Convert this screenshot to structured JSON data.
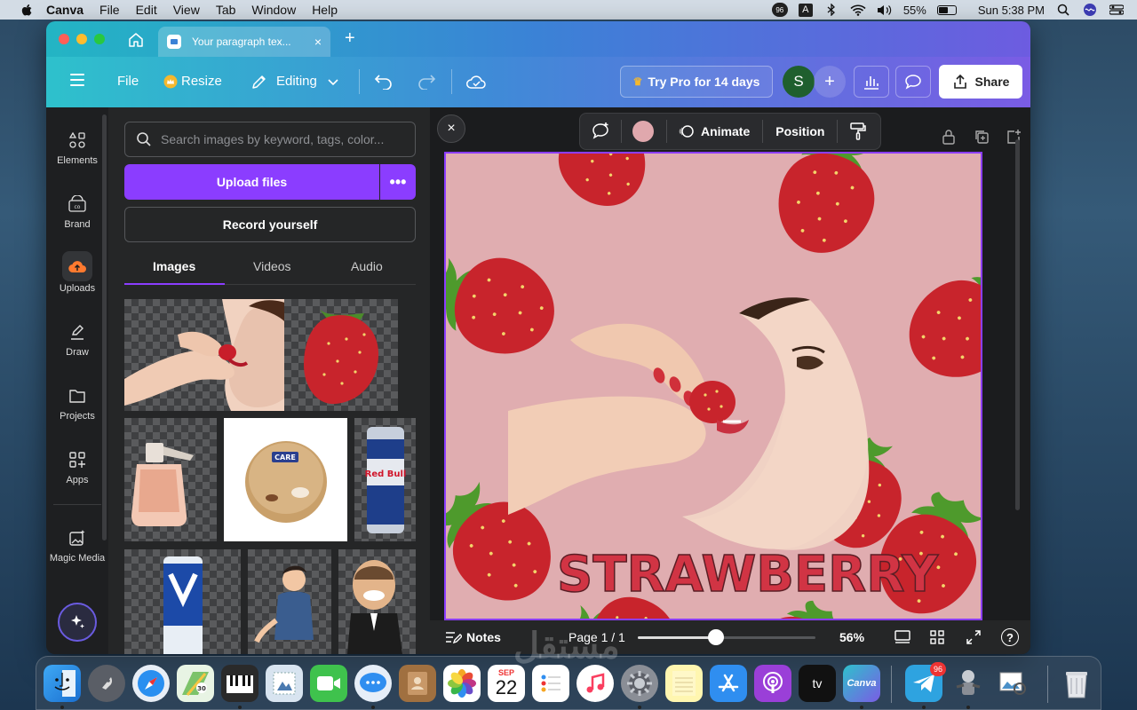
{
  "menubar": {
    "app": "Canva",
    "items": [
      "File",
      "Edit",
      "View",
      "Tab",
      "Window",
      "Help"
    ],
    "badge": "96",
    "input_letter": "A",
    "battery": "55%",
    "clock": "Sun 5:38 PM"
  },
  "browser": {
    "tab_title": "Your paragraph tex...",
    "tab_close": "×",
    "new_tab": "+"
  },
  "toolbar": {
    "file": "File",
    "resize": "Resize",
    "editing": "Editing",
    "try_pro": "Try Pro for 14 days",
    "avatar_letter": "S",
    "share": "Share"
  },
  "rail": {
    "items": [
      {
        "label": "Elements",
        "icon": "elements-icon"
      },
      {
        "label": "Brand",
        "icon": "brand-icon"
      },
      {
        "label": "Uploads",
        "icon": "uploads-icon"
      },
      {
        "label": "Draw",
        "icon": "draw-icon"
      },
      {
        "label": "Projects",
        "icon": "projects-icon"
      },
      {
        "label": "Apps",
        "icon": "apps-icon"
      },
      {
        "label": "Magic Media",
        "icon": "magic-media-icon"
      }
    ],
    "active": "Uploads"
  },
  "panel": {
    "search_placeholder": "Search images by keyword, tags, color...",
    "upload_label": "Upload files",
    "upload_more": "•••",
    "record_label": "Record yourself",
    "tabs": [
      "Images",
      "Videos",
      "Audio"
    ],
    "active_tab": "Images",
    "thumbs": [
      "woman eating strawberry",
      "strawberry",
      "perfume bottle",
      "Care skin cream jar",
      "Red Bull can",
      "energy drink can",
      "cartoon man",
      "3D cartoon businessman"
    ],
    "can_text": "Red Bull",
    "jar_text": "CARE"
  },
  "canvas": {
    "close": "×",
    "animate": "Animate",
    "position": "Position",
    "swatch_color": "#e0a8ad",
    "design_bg": "#e0adb0",
    "title_text": "STRAWBERRY",
    "title_color": "#d13444"
  },
  "footer": {
    "notes": "Notes",
    "page": "Page 1 / 1",
    "zoom": "56%",
    "zoom_level": 0.44,
    "help": "?"
  },
  "dock": {
    "calendar_month": "SEP",
    "calendar_day": "22",
    "tv_label": "tv",
    "canva_label": "Canva",
    "telegram_badge": "96"
  },
  "watermark": "مستقل"
}
